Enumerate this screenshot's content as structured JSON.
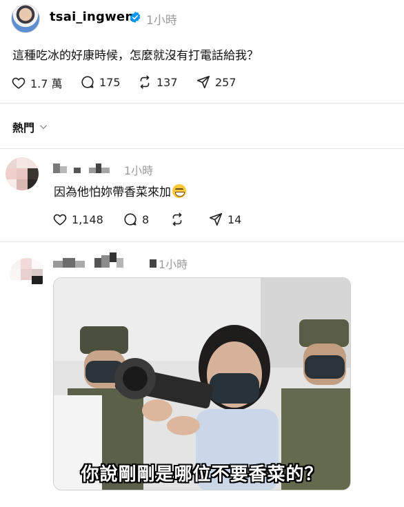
{
  "post": {
    "username": "tsai_ingwen",
    "time": "1小時",
    "text": "這種吃冰的好康時候，怎麼就沒有打電話給我？",
    "likes": "1.7 萬",
    "comments": "175",
    "reposts": "137",
    "shares": "257"
  },
  "sort": {
    "label": "熱門"
  },
  "replies": [
    {
      "time": "1小時",
      "text": "因為他怕妳帶香菜來加",
      "emoji": "grinning-squinting-face",
      "likes": "1,148",
      "comments": "8",
      "shares": "14"
    },
    {
      "time": "1小時",
      "image_caption": "你說剛剛是哪位不要香菜的？"
    }
  ],
  "colors": {
    "muted": "#999999",
    "verified": "#0095f6",
    "divider": "#e3e3e3"
  },
  "icons": [
    "heart-icon",
    "comment-icon",
    "repost-icon",
    "share-icon",
    "chevron-down-icon",
    "verified-icon"
  ]
}
